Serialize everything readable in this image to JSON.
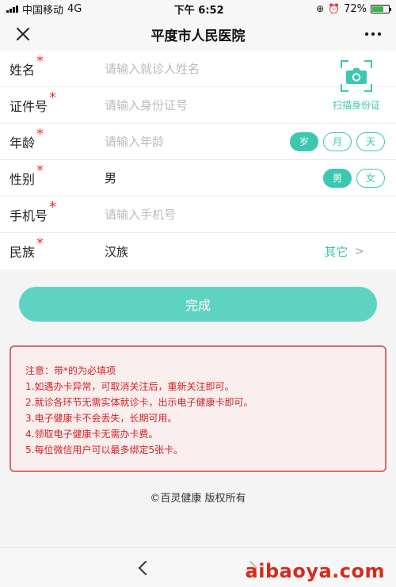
{
  "status": {
    "carrier": "中国移动",
    "network": "4G",
    "time": "下午 6:52",
    "battery_pct": "72%",
    "battery_level": 0.72
  },
  "header": {
    "title": "平度市人民医院"
  },
  "form": {
    "name": {
      "label": "姓名",
      "required": "*",
      "placeholder": "请输入就诊人姓名"
    },
    "id_number": {
      "label": "证件号",
      "required": "*",
      "placeholder": "请输入身份证号"
    },
    "age": {
      "label": "年龄",
      "required": "*",
      "placeholder": "请输入年龄",
      "units": [
        "岁",
        "月",
        "天"
      ],
      "selected_unit": "岁"
    },
    "gender": {
      "label": "性别",
      "required": "*",
      "value": "男",
      "options": [
        "男",
        "女"
      ],
      "selected": "男"
    },
    "phone": {
      "label": "手机号",
      "required": "*",
      "placeholder": "请输入手机号"
    },
    "ethnicity": {
      "label": "民族",
      "required": "*",
      "value": "汉族",
      "other_label": "其它",
      "chevron": ">"
    }
  },
  "scan": {
    "label": "扫描身份证",
    "icon": "camera-icon"
  },
  "actions": {
    "done_label": "完成"
  },
  "notice": {
    "lines": [
      "注意：带*的为必填项",
      "1.如遇办卡异常，可取消关注后，重新关注即可。",
      "2.就诊各环节无需实体就诊卡，出示电子健康卡即可。",
      "3.电子健康卡不会丢失，长期可用。",
      "4.领取电子健康卡无需办卡费。",
      "5.每位微信用户可以最多绑定5张卡。"
    ]
  },
  "footer": {
    "copyright": "©百灵健康  版权所有"
  },
  "watermark": {
    "text": "aibaoya.com"
  },
  "colors": {
    "accent": "#3cc8b0",
    "button": "#5fd3c1",
    "notice_border": "#d96b6b",
    "notice_text": "#d52222",
    "required": "#ee3333"
  }
}
